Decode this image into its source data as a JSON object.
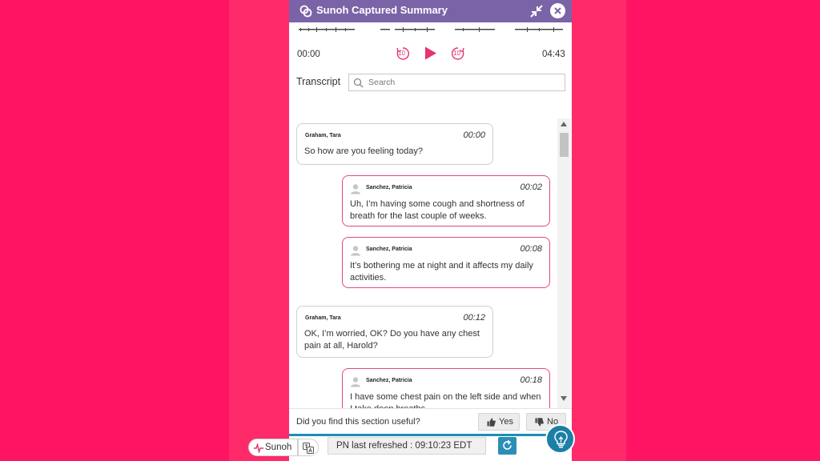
{
  "window": {
    "title": "Sunoh Captured Summary",
    "logo_icon": "sunoh-logo-icon",
    "collapse_icon": "collapse-arrows-icon",
    "close_icon": "close-icon"
  },
  "player": {
    "current_time": "00:00",
    "total_time": "04:43",
    "rewind_label": "10",
    "forward_label": "10",
    "play_icon": "play-icon"
  },
  "transcript": {
    "label": "Transcript",
    "search_placeholder": "Search"
  },
  "messages": [
    {
      "speaker": "Graham, Tara",
      "time": "00:00",
      "text": "So how are you feeling today?",
      "role": "provider"
    },
    {
      "speaker": "Sanchez, Patricia",
      "time": "00:02",
      "text": "Uh, I’m having some cough and shortness of breath for the last couple of weeks.",
      "role": "patient"
    },
    {
      "speaker": "Sanchez, Patricia",
      "time": "00:08",
      "text": "It’s bothering me at night and it affects my daily activities.",
      "role": "patient"
    },
    {
      "speaker": "Graham, Tara",
      "time": "00:12",
      "text": "OK, I’m worried, OK? Do you have any chest pain at all, Harold?",
      "role": "provider"
    },
    {
      "speaker": "Sanchez, Patricia",
      "time": "00:18",
      "text": "I have some chest pain on the left side and when I take deep breaths.",
      "role": "patient"
    }
  ],
  "feedback": {
    "question": "Did you find this section useful?",
    "yes_label": "Yes",
    "no_label": "No"
  },
  "footer": {
    "brand_label": "Sunoh",
    "refreshed_label": "PN last refreshed : 09:10:23 EDT"
  },
  "colors": {
    "background": "#ff1463",
    "header": "#7b63a8",
    "accent": "#e8336b",
    "teal": "#1b8fb5"
  }
}
